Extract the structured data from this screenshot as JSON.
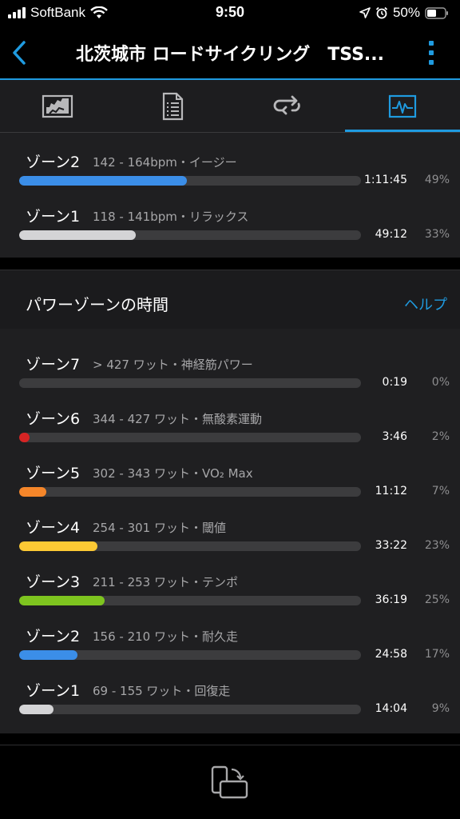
{
  "status_bar": {
    "carrier": "SoftBank",
    "time": "9:50",
    "battery": "50%"
  },
  "nav": {
    "title": "北茨城市 ロードサイクリング　TSS..."
  },
  "tabs": [
    {
      "name": "chart-tab",
      "icon": "chart-icon"
    },
    {
      "name": "details-tab",
      "icon": "document-icon"
    },
    {
      "name": "laps-tab",
      "icon": "loop-icon"
    },
    {
      "name": "zones-tab",
      "icon": "pulse-icon",
      "selected": true
    }
  ],
  "heart_rate_zones": [
    {
      "label": "ゾーン2",
      "detail": "142 - 164bpm・イージー",
      "time": "1:11:45",
      "percent": "49%",
      "fill": 0.49,
      "color": "#3b8ee8"
    },
    {
      "label": "ゾーン1",
      "detail": "118 - 141bpm・リラックス",
      "time": "49:12",
      "percent": "33%",
      "fill": 0.34,
      "color": "#d4d4d6"
    }
  ],
  "power_zones": {
    "title": "パワーゾーンの時間",
    "help": "ヘルプ",
    "zones": [
      {
        "label": "ゾーン7",
        "detail": "> 427 ワット・神経筋パワー",
        "time": "0:19",
        "percent": "0%",
        "fill": 0.0,
        "color": "#9a9a9c"
      },
      {
        "label": "ゾーン6",
        "detail": "344 - 427 ワット・無酸素運動",
        "time": "3:46",
        "percent": "2%",
        "fill": 0.03,
        "color": "#d62424"
      },
      {
        "label": "ゾーン5",
        "detail": "302 - 343 ワット・VO₂ Max",
        "time": "11:12",
        "percent": "7%",
        "fill": 0.08,
        "color": "#f5862a"
      },
      {
        "label": "ゾーン4",
        "detail": "254 - 301 ワット・閾値",
        "time": "33:22",
        "percent": "23%",
        "fill": 0.23,
        "color": "#fcc934"
      },
      {
        "label": "ゾーン3",
        "detail": "211 - 253 ワット・テンポ",
        "time": "36:19",
        "percent": "25%",
        "fill": 0.25,
        "color": "#7ec41f"
      },
      {
        "label": "ゾーン2",
        "detail": "156 - 210 ワット・耐久走",
        "time": "24:58",
        "percent": "17%",
        "fill": 0.17,
        "color": "#3b8ee8"
      },
      {
        "label": "ゾーン1",
        "detail": "69 - 155 ワット・回復走",
        "time": "14:04",
        "percent": "9%",
        "fill": 0.1,
        "color": "#d4d4d6"
      }
    ]
  },
  "bottom_bar": {
    "icon": "rotate-screen-icon"
  }
}
